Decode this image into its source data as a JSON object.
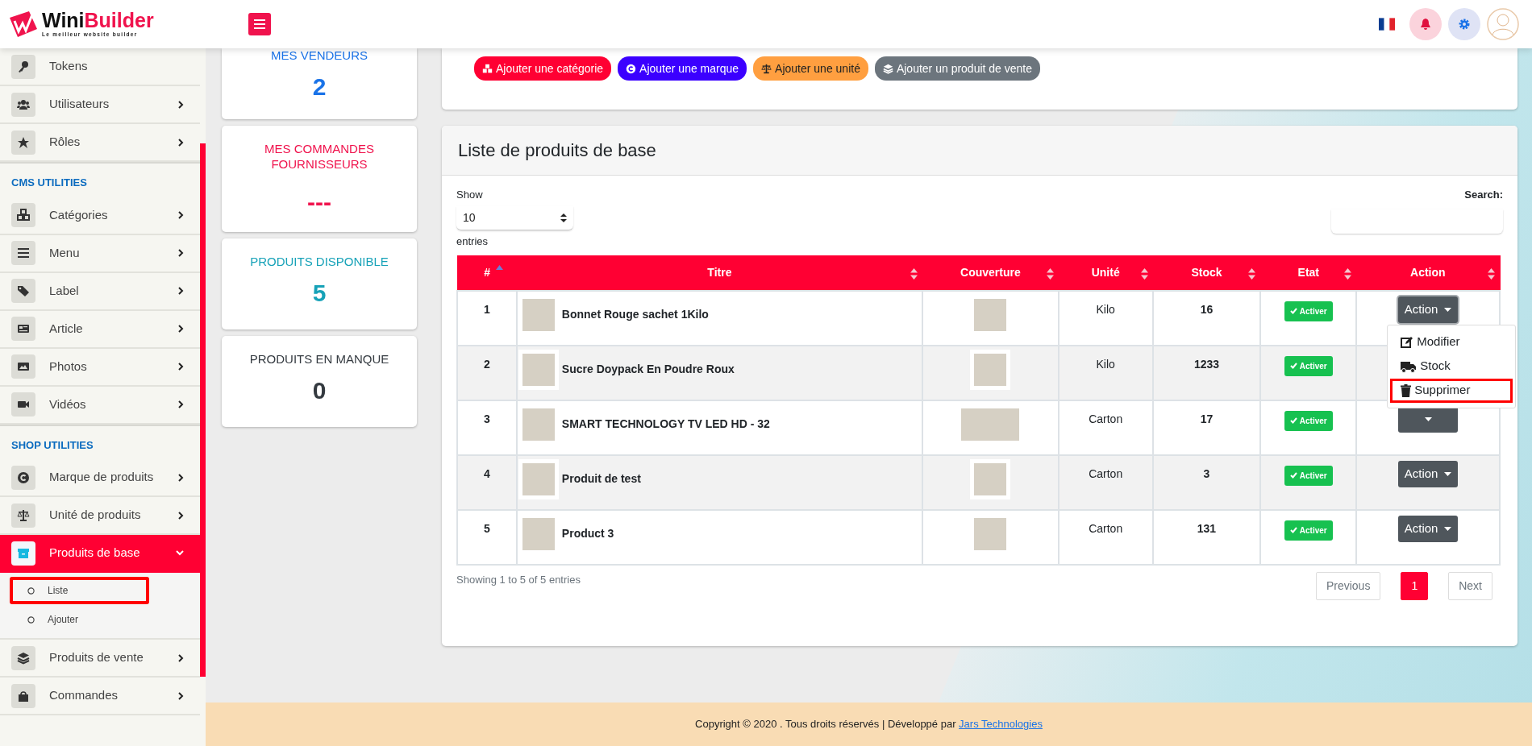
{
  "header": {
    "logo": {
      "name": "Wini",
      "accent": "Builder",
      "tagline": "Le meilleur website builder"
    }
  },
  "sidebar": {
    "sections": [
      {
        "items": [
          {
            "label": "Tokens",
            "selected": false
          },
          {
            "label": "Utilisateurs",
            "selected": false,
            "expanded": false
          },
          {
            "label": "Rôles",
            "selected": false,
            "expanded": false
          }
        ]
      },
      {
        "title": "CMS UTILITIES",
        "items": [
          {
            "label": "Catégories",
            "selected": false,
            "expanded": false
          },
          {
            "label": "Menu",
            "selected": false,
            "expanded": false
          },
          {
            "label": "Label",
            "selected": false,
            "expanded": false
          },
          {
            "label": "Article",
            "selected": false,
            "expanded": false
          },
          {
            "label": "Photos",
            "selected": false,
            "expanded": false
          },
          {
            "label": "Vidéos",
            "selected": false,
            "expanded": false
          }
        ]
      },
      {
        "title": "SHOP UTILITIES",
        "items": [
          {
            "label": "Marque de produits",
            "selected": false,
            "expanded": false
          },
          {
            "label": "Unité de produits",
            "selected": false,
            "expanded": false
          },
          {
            "label": "Produits de base",
            "selected": true,
            "expanded": true,
            "children": [
              {
                "label": "Liste",
                "highlighted": true
              },
              {
                "label": "Ajouter",
                "highlighted": false
              }
            ]
          },
          {
            "label": "Produits de vente",
            "selected": false,
            "expanded": false
          },
          {
            "label": "Commandes",
            "selected": false,
            "expanded": false
          }
        ]
      }
    ]
  },
  "stats": [
    {
      "title": "MES VENDEURS",
      "value": "2",
      "color": "#1a73e8"
    },
    {
      "title": "MES COMMANDES FOURNISSEURS",
      "value": "---",
      "color": "#f0134d"
    },
    {
      "title": "PRODUITS DISPONIBLE",
      "value": "5",
      "color": "#17a2b8"
    },
    {
      "title": "PRODUITS EN MANQUE",
      "value": "0",
      "color": "#343a40"
    }
  ],
  "quick_actions": [
    {
      "label": "Ajouter une catégorie",
      "color": "#ff0033"
    },
    {
      "label": "Ajouter une marque",
      "color": "#3b00ff"
    },
    {
      "label": "Ajouter une unité",
      "color": "#ff9f40"
    },
    {
      "label": "Ajouter un produit de vente",
      "color": "#6c757d"
    }
  ],
  "list_card": {
    "title": "Liste de produits de base",
    "show_label": "Show",
    "page_size": "10",
    "entries_label": "entries",
    "search_label": "Search:",
    "table": {
      "columns": [
        {
          "label": "#",
          "sorted": true
        },
        {
          "label": "Titre",
          "sorted": false
        },
        {
          "label": "Couverture",
          "sorted": false
        },
        {
          "label": "Unité",
          "sorted": false
        },
        {
          "label": "Stock",
          "sorted": false
        },
        {
          "label": "Etat",
          "sorted": false
        },
        {
          "label": "Action",
          "sorted": false
        }
      ],
      "rows": [
        {
          "number": "1",
          "title": "Bonnet Rouge sachet 1Kilo",
          "wide_cover": false,
          "unit": "Kilo",
          "stock": "16",
          "status": "Activer",
          "action": "Action",
          "menu_open": true,
          "menu": [
            {
              "label": "Modifier",
              "highlighted": false
            },
            {
              "label": "Stock",
              "highlighted": false
            },
            {
              "label": "Supprimer",
              "highlighted": true
            }
          ]
        },
        {
          "number": "2",
          "title": "Sucre Doypack En Poudre Roux",
          "wide_cover": false,
          "unit": "Kilo",
          "stock": "1233",
          "status": "Activer"
        },
        {
          "number": "3",
          "title": "SMART TECHNOLOGY TV LED HD - 32",
          "wide_cover": true,
          "unit": "Carton",
          "stock": "17",
          "status": "Activer"
        },
        {
          "number": "4",
          "title": "Produit de test",
          "wide_cover": false,
          "unit": "Carton",
          "stock": "3",
          "status": "Activer",
          "action": "Action"
        },
        {
          "number": "5",
          "title": "Product 3",
          "wide_cover": false,
          "unit": "Carton",
          "stock": "131",
          "status": "Activer",
          "action": "Action"
        }
      ]
    },
    "info": "Showing 1 to 5 of 5 entries",
    "pagination": {
      "previous": "Previous",
      "pages": [
        {
          "label": "1",
          "selected": true
        }
      ],
      "next": "Next"
    }
  },
  "footer": {
    "text": "Copyright © 2020 . Tous droits réservés | Développé par ",
    "link": "Jars Technologies"
  }
}
